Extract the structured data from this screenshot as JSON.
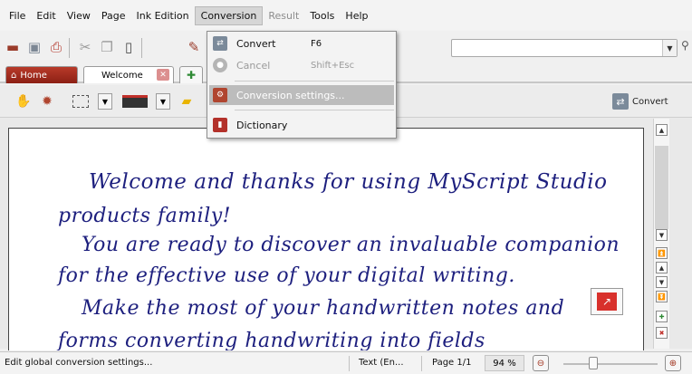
{
  "menu": {
    "items": [
      "File",
      "Edit",
      "View",
      "Page",
      "Ink Edition",
      "Conversion",
      "Result",
      "Tools",
      "Help"
    ]
  },
  "conversion_menu": {
    "convert": {
      "label": "Convert",
      "shortcut": "F6"
    },
    "cancel": {
      "label": "Cancel",
      "shortcut": "Shift+Esc"
    },
    "settings": {
      "label": "Conversion settings..."
    },
    "dictionary": {
      "label": "Dictionary"
    }
  },
  "tabs": {
    "home": "Home",
    "welcome": "Welcome"
  },
  "toolbar2": {
    "convert_label": "Convert"
  },
  "document": {
    "lines": [
      "Welcome and thanks for using MyScript Studio",
      "products family!",
      "You are ready to discover an invaluable companion",
      "for the effective use of your digital writing.",
      "Make the most of your handwritten notes and",
      "forms converting handwriting into fields"
    ]
  },
  "status": {
    "message": "Edit global conversion settings...",
    "language": "Text (En...",
    "page": "Page 1/1",
    "zoom": "94 %"
  },
  "colors": {
    "ink": "#1d1f7e",
    "home_tab": "#b83a2a",
    "accent_red": "#d8302b"
  }
}
